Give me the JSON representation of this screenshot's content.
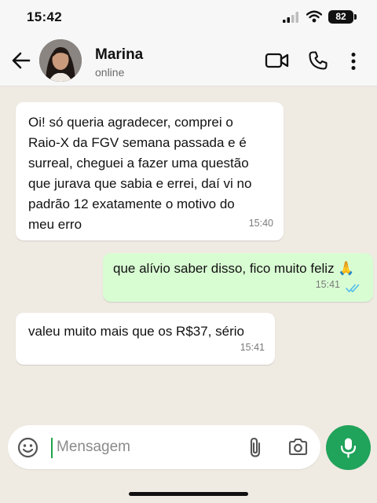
{
  "status_bar": {
    "time": "15:42",
    "battery": "82"
  },
  "header": {
    "contact_name": "Marina",
    "status": "online"
  },
  "messages": [
    {
      "direction": "incoming",
      "text": "Oi! só queria agradecer, comprei o\nRaio-X da FGV semana passada e é\nsurreal, cheguei a fazer uma questão\nque jurava que sabia e errei, daí vi no\npadrão 12 exatamente o motivo do\nmeu erro",
      "time": "15:40"
    },
    {
      "direction": "outgoing",
      "text": "que alívio saber disso, fico muito feliz 🙏",
      "time": "15:41",
      "read": true
    },
    {
      "direction": "incoming",
      "text": "valeu muito mais que os R$37, sério",
      "time": "15:41"
    }
  ],
  "input": {
    "placeholder": "Mensagem",
    "value": ""
  },
  "icons": {
    "back": "arrow-left-icon",
    "video": "video-camera-icon",
    "call": "phone-icon",
    "menu": "more-vertical-icon",
    "emoji": "emoji-icon",
    "attach": "paperclip-icon",
    "camera": "camera-icon",
    "mic": "microphone-icon"
  },
  "colors": {
    "accent_green": "#20a35a",
    "outgoing_bubble": "#d9fdd3",
    "incoming_bubble": "#ffffff",
    "chat_background": "#efeae2",
    "read_ticks": "#53bdeb"
  }
}
